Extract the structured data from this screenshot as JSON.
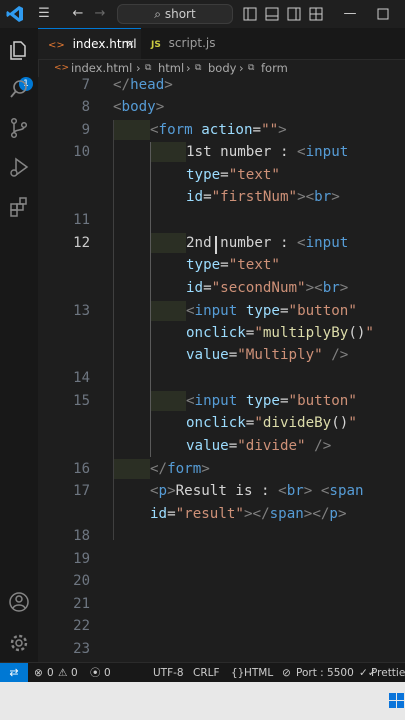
{
  "titlebar": {
    "search_text": "short"
  },
  "tabs": [
    {
      "icon": "<>",
      "label": "index.html",
      "close": "×"
    },
    {
      "icon": "JS",
      "label": "script.js"
    }
  ],
  "activity": {
    "badge": "1"
  },
  "breadcrumb": {
    "items": [
      "index.html",
      "html",
      "body",
      "form"
    ]
  },
  "editor": {
    "line_numbers": [
      "7",
      "8",
      "9",
      "10",
      "11",
      "12",
      "13",
      "14",
      "15",
      "16",
      "17",
      "18",
      "19",
      "20",
      "21",
      "22",
      "23"
    ],
    "current_line": "12"
  },
  "statusbar": {
    "errors": "0",
    "warnings": "0",
    "ports": "0",
    "encoding": "UTF-8",
    "eol": "CRLF",
    "language": "HTML",
    "port": "Port : 5500",
    "prettier": "Prettier"
  },
  "colors": {
    "accent": "#0078d4",
    "tag": "#569cd6",
    "attr": "#9cdcfe",
    "string": "#ce9178",
    "function": "#dcdcaa"
  }
}
